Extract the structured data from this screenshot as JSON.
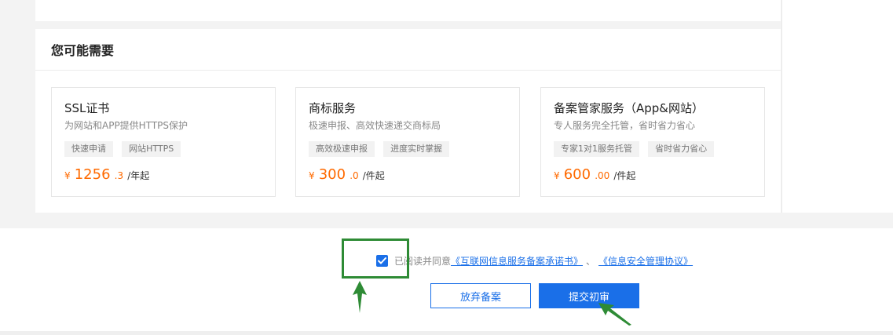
{
  "recommend": {
    "title": "您可能需要",
    "cards": [
      {
        "title": "SSL证书",
        "desc": "为网站和APP提供HTTPS保护",
        "tags": [
          "快速申请",
          "网站HTTPS"
        ],
        "price": {
          "currency": "¥",
          "int": "1256",
          "dec": ".3",
          "unit": "/年起"
        }
      },
      {
        "title": "商标服务",
        "desc": "极速申报、高效快速递交商标局",
        "tags": [
          "高效极速申报",
          "进度实时掌握"
        ],
        "price": {
          "currency": "¥",
          "int": "300",
          "dec": ".0",
          "unit": "/件起"
        }
      },
      {
        "title": "备案管家服务（App&网站）",
        "desc": "专人服务完全托管，省时省力省心",
        "tags": [
          "专家1对1服务托管",
          "省时省力省心"
        ],
        "price": {
          "currency": "¥",
          "int": "600",
          "dec": ".00",
          "unit": "/件起"
        }
      }
    ]
  },
  "agreement": {
    "checked": true,
    "prefix": "已阅读并同意",
    "link1": "《互联网信息服务备案承诺书》",
    "sep": "、",
    "link2": "《信息安全管理协议》"
  },
  "actions": {
    "abandon_label": "放弃备案",
    "submit_label": "提交初审"
  },
  "colors": {
    "primary": "#1a6fe8",
    "price": "#ff6a00",
    "annotation": "#2e8b35"
  },
  "icons": {
    "checkbox": "check-icon"
  }
}
